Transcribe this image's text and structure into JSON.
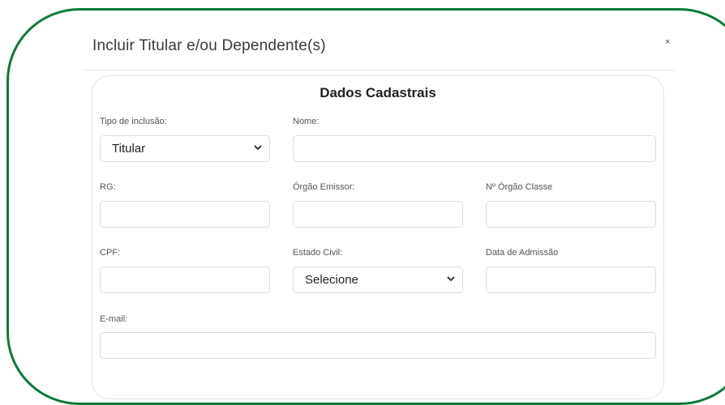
{
  "dialog": {
    "title": "Incluir Titular e/ou Dependente(s)",
    "close_glyph": "×"
  },
  "form": {
    "section_title": "Dados Cadastrais",
    "tipo_inclusao": {
      "label": "Tipo de inclusão:",
      "value": "Titular"
    },
    "nome": {
      "label": "Nome:",
      "value": ""
    },
    "rg": {
      "label": "RG:",
      "value": ""
    },
    "orgao_emissor": {
      "label": "Órgão Emissor:",
      "value": ""
    },
    "orgao_classe": {
      "label": "Nº Órgão Classe",
      "value": ""
    },
    "cpf": {
      "label": "CPF:",
      "value": ""
    },
    "estado_civil": {
      "label": "Estado Civil:",
      "value": "Selecione"
    },
    "data_admissao": {
      "label": "Data de Admissão",
      "value": ""
    },
    "email": {
      "label": "E-mail:",
      "value": ""
    }
  },
  "colors": {
    "frame_border": "#0b7a3a"
  },
  "icons": {
    "select_arrow": "chevron-down-icon"
  }
}
